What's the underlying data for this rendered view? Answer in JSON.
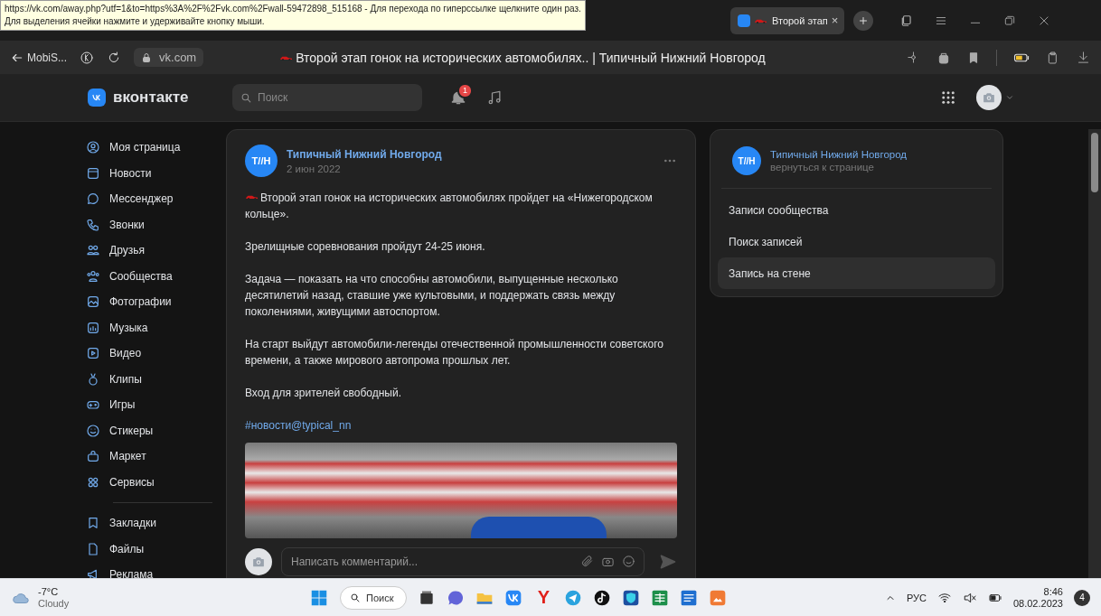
{
  "tooltip": {
    "lines": [
      "https://vk.com/away.php?utf=1&to=https%3A%2F%2Fvk.com%2Fwall-59472898_515168 - Для перехода по гиперссылке щелкните один раз.",
      "Для выделения ячейки нажмите и удерживайте кнопку мыши."
    ]
  },
  "browser": {
    "tab": {
      "title": "Второй этап",
      "close": "×",
      "selected": true
    },
    "back_label": "MobiS...",
    "address": "vk.com",
    "page_title": "Второй этап гонок на исторических автомобилях.. | Типичный Нижний Новгород"
  },
  "header": {
    "logo": "вконтакте",
    "search": {
      "placeholder": "Поиск"
    },
    "notification_count": "1"
  },
  "sidebar": {
    "items": [
      {
        "label": "Моя страница"
      },
      {
        "label": "Новости"
      },
      {
        "label": "Мессенджер"
      },
      {
        "label": "Звонки"
      },
      {
        "label": "Друзья"
      },
      {
        "label": "Сообщества"
      },
      {
        "label": "Фотографии"
      },
      {
        "label": "Музыка"
      },
      {
        "label": "Видео"
      },
      {
        "label": "Клипы"
      },
      {
        "label": "Игры"
      },
      {
        "label": "Стикеры"
      },
      {
        "label": "Маркет"
      },
      {
        "label": "Сервисы"
      }
    ],
    "secondary_items": [
      {
        "label": "Закладки"
      },
      {
        "label": "Файлы"
      },
      {
        "label": "Реклама"
      }
    ]
  },
  "post": {
    "avatar_text": "Т//Н",
    "author": "Типичный Нижний Новгород",
    "date": "2 июн 2022",
    "paragraphs": [
      "Второй этап гонок на исторических автомобилях пройдет на «Нижегородском кольце».",
      "Зрелищные соревнования пройдут 24-25 июня.",
      "Задача — показать на что способны автомобили, выпущенные несколько десятилетий назад, ставшие уже культовыми, и поддержать связь между поколениями, живущими автоспортом.",
      "На старт выйдут автомобили-легенды отечественной промышленности советского времени, а также мирового автопрома прошлых лет.",
      "Вход для зрителей свободный."
    ],
    "hashtag": "#новости@typical_nn",
    "comment": {
      "placeholder": "Написать комментарий..."
    }
  },
  "group_menu": {
    "avatar_text": "Т//Н",
    "name": "Типичный Нижний Новгород",
    "subtitle": "вернуться к странице",
    "items": [
      {
        "label": "Записи сообщества",
        "selected": false
      },
      {
        "label": "Поиск записей",
        "selected": false
      },
      {
        "label": "Запись на стене",
        "selected": true
      }
    ]
  },
  "taskbar": {
    "weather": {
      "temperature": "-7°C",
      "condition": "Cloudy"
    },
    "search_label": "Поиск",
    "app_letter": "Y",
    "language": "РУС",
    "time": "8:46",
    "date": "08.02.2023",
    "notification_count": "4"
  }
}
